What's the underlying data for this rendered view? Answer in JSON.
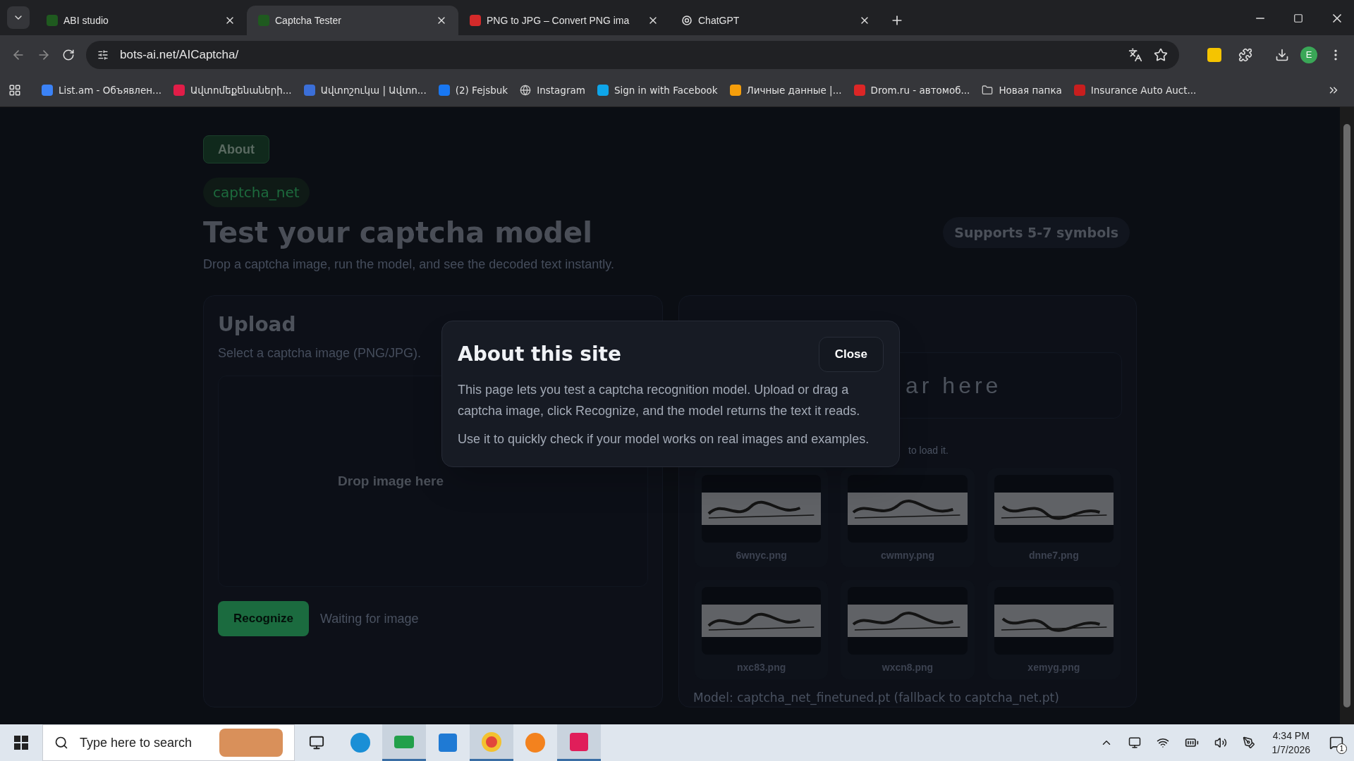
{
  "tabs": [
    {
      "title": "ABI studio",
      "kind": "studio",
      "selected": false
    },
    {
      "title": "Captcha Tester",
      "kind": "studio",
      "selected": true
    },
    {
      "title": "PNG to JPG – Convert PNG ima",
      "kind": "png",
      "selected": false
    },
    {
      "title": "ChatGPT",
      "kind": "chat",
      "selected": false
    }
  ],
  "address": "bots-ai.net/AICaptcha/",
  "profile": "E",
  "bookmarks": [
    {
      "label": "List.am - Объявлен...",
      "kind": "site"
    },
    {
      "label": "Ավտոմեքենաների...",
      "kind": "site"
    },
    {
      "label": "Ավտոշուկա | Ավտո...",
      "kind": "site"
    },
    {
      "label": "(2) Fejsbuk",
      "kind": "site"
    },
    {
      "label": "Instagram",
      "kind": "globe"
    },
    {
      "label": "Sign in with Facebook",
      "kind": "site"
    },
    {
      "label": "Личные данные |...",
      "kind": "site"
    },
    {
      "label": "Drom.ru - автомоб...",
      "kind": "site"
    },
    {
      "label": "Новая папка",
      "kind": "folder"
    },
    {
      "label": "Insurance Auto Auct...",
      "kind": "site"
    }
  ],
  "page": {
    "about_button": "About",
    "model_pill": "captcha_net",
    "title": "Test your captcha model",
    "subtitle": "Drop a captcha image, run the model, and see the decoded text instantly.",
    "supports_pill": "Supports 5-7 symbols",
    "upload": {
      "title": "Upload",
      "hint": "Select a captcha image (PNG/JPG).",
      "drop_label": "Drop image here",
      "button": "Recognize",
      "status": "Waiting for image"
    },
    "result": {
      "partial_text": "ar here",
      "hint": "to load it.",
      "examples": [
        "6wnyc.png",
        "cwmny.png",
        "dnne7.png",
        "nxc83.png",
        "wxcn8.png",
        "xemyg.png"
      ],
      "model_note": "Model: captcha_net_finetuned.pt (fallback to captcha_net.pt)"
    }
  },
  "modal": {
    "title": "About this site",
    "close": "Close",
    "paragraphs": [
      "This page lets you test a captcha recognition model. Upload or drag a captcha image, click Recognize, and the model returns the text it reads.",
      "Use it to quickly check if your model works on real images and examples."
    ]
  },
  "taskbar": {
    "search_placeholder": "Type here to search",
    "time": "4:34 PM",
    "date": "1/7/2026",
    "notifications": "1"
  }
}
